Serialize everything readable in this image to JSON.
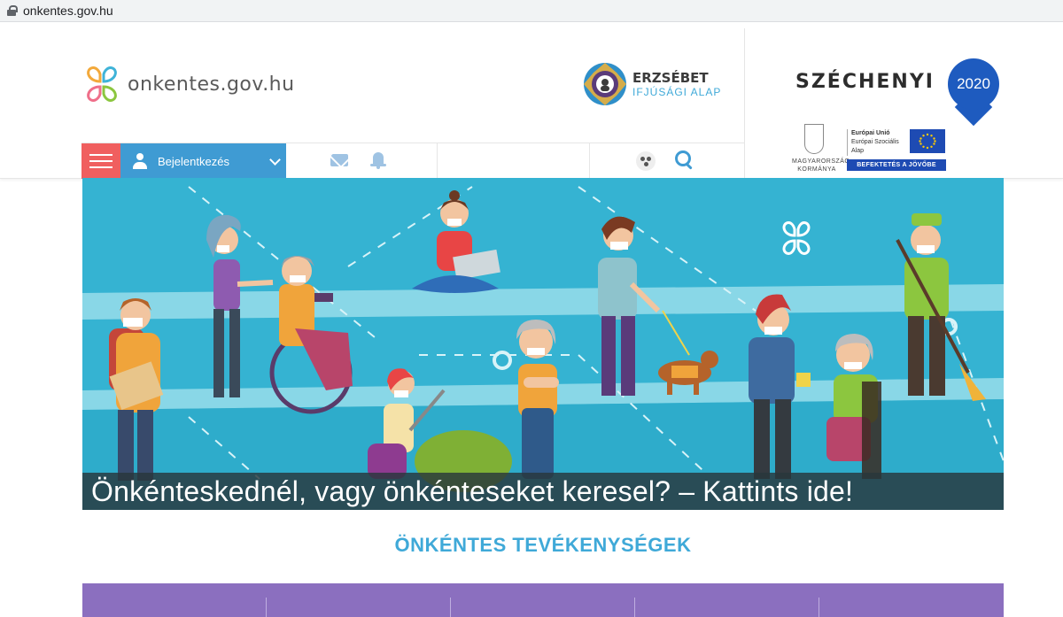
{
  "browser": {
    "url": "onkentes.gov.hu"
  },
  "header": {
    "logo_text": "onkentes.gov.hu",
    "erzsebet": {
      "line1": "ERZSÉBET",
      "line2": "IFJÚSÁGI ALAP"
    },
    "szechenyi": {
      "title": "SZÉCHENYI",
      "year": "2020",
      "gov_line1": "MAGYARORSZÁG",
      "gov_line2": "KORMÁNYA",
      "eu_line1": "Európai Unió",
      "eu_line2": "Európai Szociális",
      "eu_line3": "Alap",
      "slogan": "BEFEKTETÉS A JÖVŐBE"
    }
  },
  "nav": {
    "login_label": "Bejelentkezés"
  },
  "hero": {
    "caption": "Önkénteskednél, vagy önkénteseket keresel? – Kattints ide!"
  },
  "section": {
    "title": "ÖNKÉNTES TEVÉKENYSÉGEK"
  },
  "colors": {
    "accent_blue": "#3f9bd3",
    "menu_red": "#f05f5f",
    "hero_bg": "#35b3d2",
    "section_purple": "#8b6fbf",
    "title_blue": "#3fa9d8"
  }
}
